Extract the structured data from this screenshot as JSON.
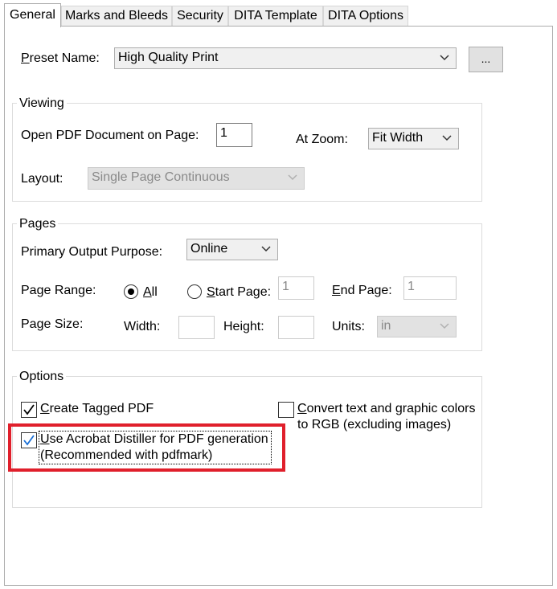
{
  "tabs": [
    "General",
    "Marks and Bleeds",
    "Security",
    "DITA Template",
    "DITA Options"
  ],
  "preset": {
    "label_u": "P",
    "label_rest": "reset Name:",
    "value": "High Quality Print",
    "more_button": "..."
  },
  "viewing": {
    "title": "Viewing",
    "open_page_label": "Open PDF Document on Page:",
    "open_page_value": "1",
    "zoom_label": "At Zoom:",
    "zoom_value": "Fit Width",
    "layout_label": "Layout:",
    "layout_value": "Single Page Continuous"
  },
  "pages": {
    "title": "Pages",
    "purpose_label": "Primary Output Purpose:",
    "purpose_value": "Online",
    "range_label": "Page Range:",
    "all_u": "A",
    "all_rest": "ll",
    "start_u": "S",
    "start_rest": "tart Page:",
    "start_value": "1",
    "end_u": "E",
    "end_rest": "nd Page:",
    "end_value": "1",
    "size_label": "Page Size:",
    "width_label": "Width:",
    "height_label": "Height:",
    "units_label": "Units:",
    "units_value": "in",
    "width_value": "",
    "height_value": ""
  },
  "options": {
    "title": "Options",
    "tagged_u": "C",
    "tagged_rest": "reate Tagged PDF",
    "tagged_checked": true,
    "rgb_u": "C",
    "rgb_rest_line1": "onvert text and graphic colors",
    "rgb_line2": "to RGB (excluding images)",
    "rgb_checked": false,
    "distiller_u": "U",
    "distiller_rest_line1": "se Acrobat Distiller for PDF generation",
    "distiller_line2": "(Recommended with pdfmark)",
    "distiller_checked": true
  },
  "colors": {
    "highlight": "#e01f2b",
    "check": "#1a6fd6"
  }
}
